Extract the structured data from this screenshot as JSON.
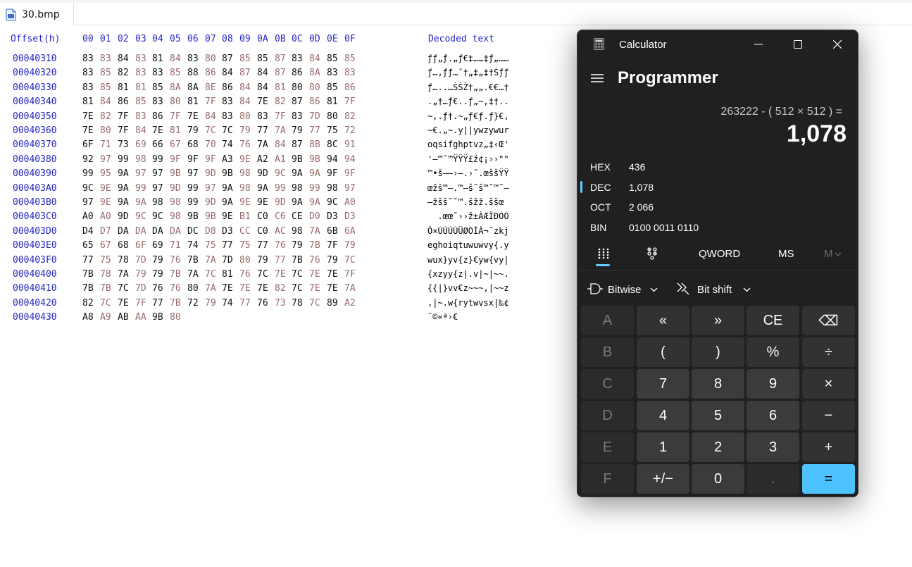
{
  "editor": {
    "tab_name": "30.bmp",
    "header": {
      "offset": "Offset(h)",
      "columns": [
        "00",
        "01",
        "02",
        "03",
        "04",
        "05",
        "06",
        "07",
        "08",
        "09",
        "0A",
        "0B",
        "0C",
        "0D",
        "0E",
        "0F"
      ],
      "decoded": "Decoded text"
    },
    "rows": [
      {
        "offset": "00040310",
        "bytes": [
          "83",
          "83",
          "84",
          "83",
          "81",
          "84",
          "83",
          "80",
          "87",
          "85",
          "85",
          "87",
          "83",
          "84",
          "85",
          "85"
        ],
        "decoded": "ƒƒ„ƒ.„ƒ€‡……‡ƒ„……"
      },
      {
        "offset": "00040320",
        "bytes": [
          "83",
          "85",
          "82",
          "83",
          "83",
          "85",
          "88",
          "86",
          "84",
          "87",
          "84",
          "87",
          "86",
          "8A",
          "83",
          "83"
        ],
        "decoded": "ƒ…‚ƒƒ…ˆ†„‡„‡†Šƒƒ"
      },
      {
        "offset": "00040330",
        "bytes": [
          "83",
          "85",
          "81",
          "81",
          "85",
          "8A",
          "8A",
          "8E",
          "86",
          "84",
          "84",
          "81",
          "80",
          "80",
          "85",
          "86"
        ],
        "decoded": "ƒ…..…ŠŠŽ†„„.€€…†"
      },
      {
        "offset": "00040340",
        "bytes": [
          "81",
          "84",
          "86",
          "85",
          "83",
          "80",
          "81",
          "7F",
          "83",
          "84",
          "7E",
          "82",
          "87",
          "86",
          "81",
          "7F"
        ],
        "decoded": ".„†…ƒ€..ƒ„~‚‡†.."
      },
      {
        "offset": "00040350",
        "bytes": [
          "7E",
          "82",
          "7F",
          "83",
          "86",
          "7F",
          "7E",
          "84",
          "83",
          "80",
          "83",
          "7F",
          "83",
          "7D",
          "80",
          "82"
        ],
        "decoded": "~‚.ƒ†.~„ƒ€ƒ.ƒ}€‚"
      },
      {
        "offset": "00040360",
        "bytes": [
          "7E",
          "80",
          "7F",
          "84",
          "7E",
          "81",
          "79",
          "7C",
          "7C",
          "79",
          "77",
          "7A",
          "79",
          "77",
          "75",
          "72"
        ],
        "decoded": "~€.„~.y||ywzywur"
      },
      {
        "offset": "00040370",
        "bytes": [
          "6F",
          "71",
          "73",
          "69",
          "66",
          "67",
          "68",
          "70",
          "74",
          "76",
          "7A",
          "84",
          "87",
          "8B",
          "8C",
          "91"
        ],
        "decoded": "oqsifghptvz„‡‹Œ'"
      },
      {
        "offset": "00040380",
        "bytes": [
          "92",
          "97",
          "99",
          "98",
          "99",
          "9F",
          "9F",
          "9F",
          "A3",
          "9E",
          "A2",
          "A1",
          "9B",
          "9B",
          "94",
          "94"
        ],
        "decoded": "'—™˜™ŸŸŸ£ž¢¡››\"\""
      },
      {
        "offset": "00040390",
        "bytes": [
          "99",
          "95",
          "9A",
          "97",
          "97",
          "9B",
          "97",
          "9D",
          "9B",
          "98",
          "9D",
          "9C",
          "9A",
          "9A",
          "9F",
          "9F"
        ],
        "decoded": "™•š——›—.›˜.œššŸŸ"
      },
      {
        "offset": "000403A0",
        "bytes": [
          "9C",
          "9E",
          "9A",
          "99",
          "97",
          "9D",
          "99",
          "97",
          "9A",
          "98",
          "9A",
          "99",
          "98",
          "99",
          "98",
          "97"
        ],
        "decoded": "œžš™—.™—š˜š™˜™˜—"
      },
      {
        "offset": "000403B0",
        "bytes": [
          "97",
          "9E",
          "9A",
          "9A",
          "98",
          "98",
          "99",
          "9D",
          "9A",
          "9E",
          "9E",
          "9D",
          "9A",
          "9A",
          "9C",
          "A0"
        ],
        "decoded": "—žšš˜˜™.šžž.ššœ "
      },
      {
        "offset": "000403C0",
        "bytes": [
          "A0",
          "A0",
          "9D",
          "9C",
          "9C",
          "98",
          "9B",
          "9B",
          "9E",
          "B1",
          "C0",
          "C6",
          "CE",
          "D0",
          "D3",
          "D3"
        ],
        "decoded": "  .œœ˜››ž±ÀÆÎÐÓÓ"
      },
      {
        "offset": "000403D0",
        "bytes": [
          "D4",
          "D7",
          "DA",
          "DA",
          "DA",
          "DA",
          "DC",
          "D8",
          "D3",
          "CC",
          "C0",
          "AC",
          "98",
          "7A",
          "6B",
          "6A"
        ],
        "decoded": "Ô×ÚÚÚÚÜØÓÌÀ¬˜zkj"
      },
      {
        "offset": "000403E0",
        "bytes": [
          "65",
          "67",
          "68",
          "6F",
          "69",
          "71",
          "74",
          "75",
          "77",
          "75",
          "77",
          "76",
          "79",
          "7B",
          "7F",
          "79"
        ],
        "decoded": "eghoiqtuwuwvy{.y"
      },
      {
        "offset": "000403F0",
        "bytes": [
          "77",
          "75",
          "78",
          "7D",
          "79",
          "76",
          "7B",
          "7A",
          "7D",
          "80",
          "79",
          "77",
          "7B",
          "76",
          "79",
          "7C"
        ],
        "decoded": "wux}yv{z}€yw{vy|"
      },
      {
        "offset": "00040400",
        "bytes": [
          "7B",
          "78",
          "7A",
          "79",
          "79",
          "7B",
          "7A",
          "7C",
          "81",
          "76",
          "7C",
          "7E",
          "7C",
          "7E",
          "7E",
          "7F"
        ],
        "decoded": "{xzyy{z|.v|~|~~."
      },
      {
        "offset": "00040410",
        "bytes": [
          "7B",
          "7B",
          "7C",
          "7D",
          "76",
          "76",
          "80",
          "7A",
          "7E",
          "7E",
          "7E",
          "82",
          "7C",
          "7E",
          "7E",
          "7A"
        ],
        "decoded": "{{|}vv€z~~~‚|~~z"
      },
      {
        "offset": "00040420",
        "bytes": [
          "82",
          "7C",
          "7E",
          "7F",
          "77",
          "7B",
          "72",
          "79",
          "74",
          "77",
          "76",
          "73",
          "78",
          "7C",
          "89",
          "A2"
        ],
        "decoded": "‚|~.w{rytwvsx|‰¢"
      },
      {
        "offset": "00040430",
        "bytes": [
          "A8",
          "A9",
          "AB",
          "AA",
          "9B",
          "80"
        ],
        "decoded": "¨©«ª›€"
      }
    ]
  },
  "calculator": {
    "title": "Calculator",
    "mode": "Programmer",
    "expression": "263222 - ( 512 × 512 ) =",
    "result": "1,078",
    "radix": [
      {
        "name": "HEX",
        "value": "436",
        "selected": false
      },
      {
        "name": "DEC",
        "value": "1,078",
        "selected": true
      },
      {
        "name": "OCT",
        "value": "2 066",
        "selected": false
      },
      {
        "name": "BIN",
        "value": "0100 0011 0110",
        "selected": false
      }
    ],
    "word_size": "QWORD",
    "memory_store": "MS",
    "memory_menu": "M",
    "bitwise": "Bitwise",
    "bitshift": "Bit shift",
    "keys": [
      [
        "A",
        "«",
        "»",
        "CE",
        "⌫"
      ],
      [
        "B",
        "(",
        ")",
        "%",
        "÷"
      ],
      [
        "C",
        "7",
        "8",
        "9",
        "×"
      ],
      [
        "D",
        "4",
        "5",
        "6",
        "−"
      ],
      [
        "E",
        "1",
        "2",
        "3",
        "+"
      ],
      [
        "F",
        "+/−",
        "0",
        ".",
        "="
      ]
    ],
    "colors": {
      "accent": "#4cc2ff",
      "background": "#202020"
    }
  }
}
